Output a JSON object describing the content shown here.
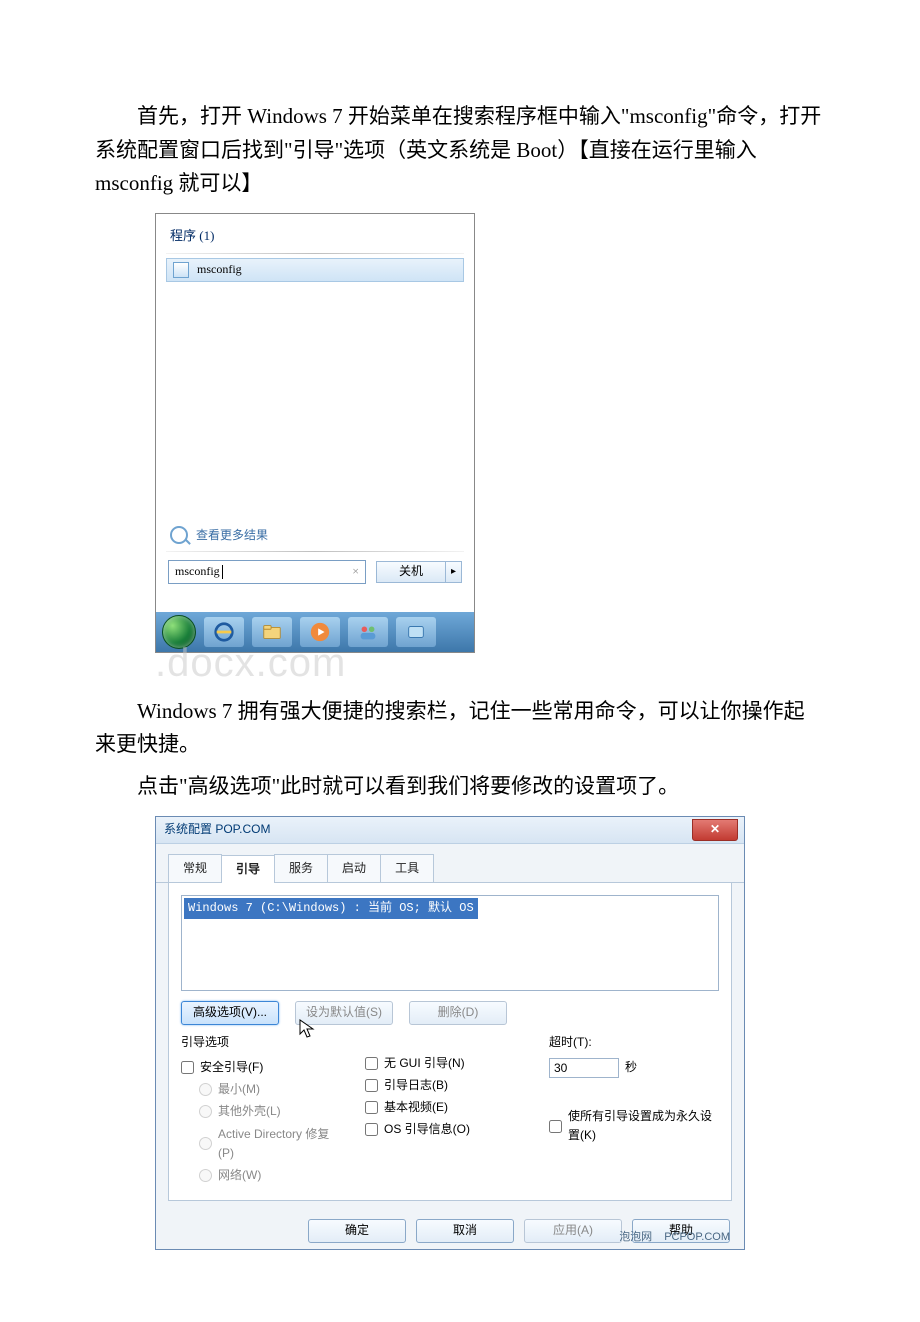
{
  "paragraphs": {
    "p1": "首先，打开 Windows 7 开始菜单在搜索程序框中输入\"msconfig\"命令，打开系统配置窗口后找到\"引导\"选项（英文系统是 Boot）【直接在运行里输入 msconfig 就可以】",
    "p2": "Windows 7 拥有强大便捷的搜索栏，记住一些常用命令，可以让你操作起来更快捷。",
    "p3": "点击\"高级选项\"此时就可以看到我们将要修改的设置项了。"
  },
  "start_menu": {
    "programs_label": "程序 (1)",
    "result": "msconfig",
    "more_results": "查看更多结果",
    "search_value": "msconfig",
    "shutdown": "关机"
  },
  "watermark": ".docx.com",
  "dialog": {
    "title": "系统配置 POP.COM",
    "close_glyph": "✕",
    "tabs": [
      "常规",
      "引导",
      "服务",
      "启动",
      "工具"
    ],
    "active_tab_index": 1,
    "os_entry": "Windows 7 (C:\\Windows) : 当前 OS; 默认 OS",
    "buttons": {
      "advanced": "高级选项(V)...",
      "set_default": "设为默认值(S)",
      "delete": "删除(D)"
    },
    "boot_group_label": "引导选项",
    "left_opts": {
      "safe_boot": "安全引导(F)",
      "minimal": "最小(M)",
      "alt_shell": "其他外壳(L)",
      "ad_repair": "Active Directory 修复(P)",
      "network": "网络(W)"
    },
    "mid_opts": {
      "no_gui": "无 GUI 引导(N)",
      "boot_log": "引导日志(B)",
      "base_video": "基本视频(E)",
      "os_boot_info": "OS 引导信息(O)"
    },
    "right": {
      "timeout_label": "超时(T):",
      "timeout_value": "30",
      "timeout_unit": "秒",
      "make_permanent": "使所有引导设置成为永久设置(K)"
    },
    "footer": {
      "ok": "确定",
      "cancel": "取消",
      "apply": "应用(A)",
      "help": "帮助"
    },
    "footnote_left": "泡泡网",
    "footnote_right": "PCPOP.COM"
  }
}
